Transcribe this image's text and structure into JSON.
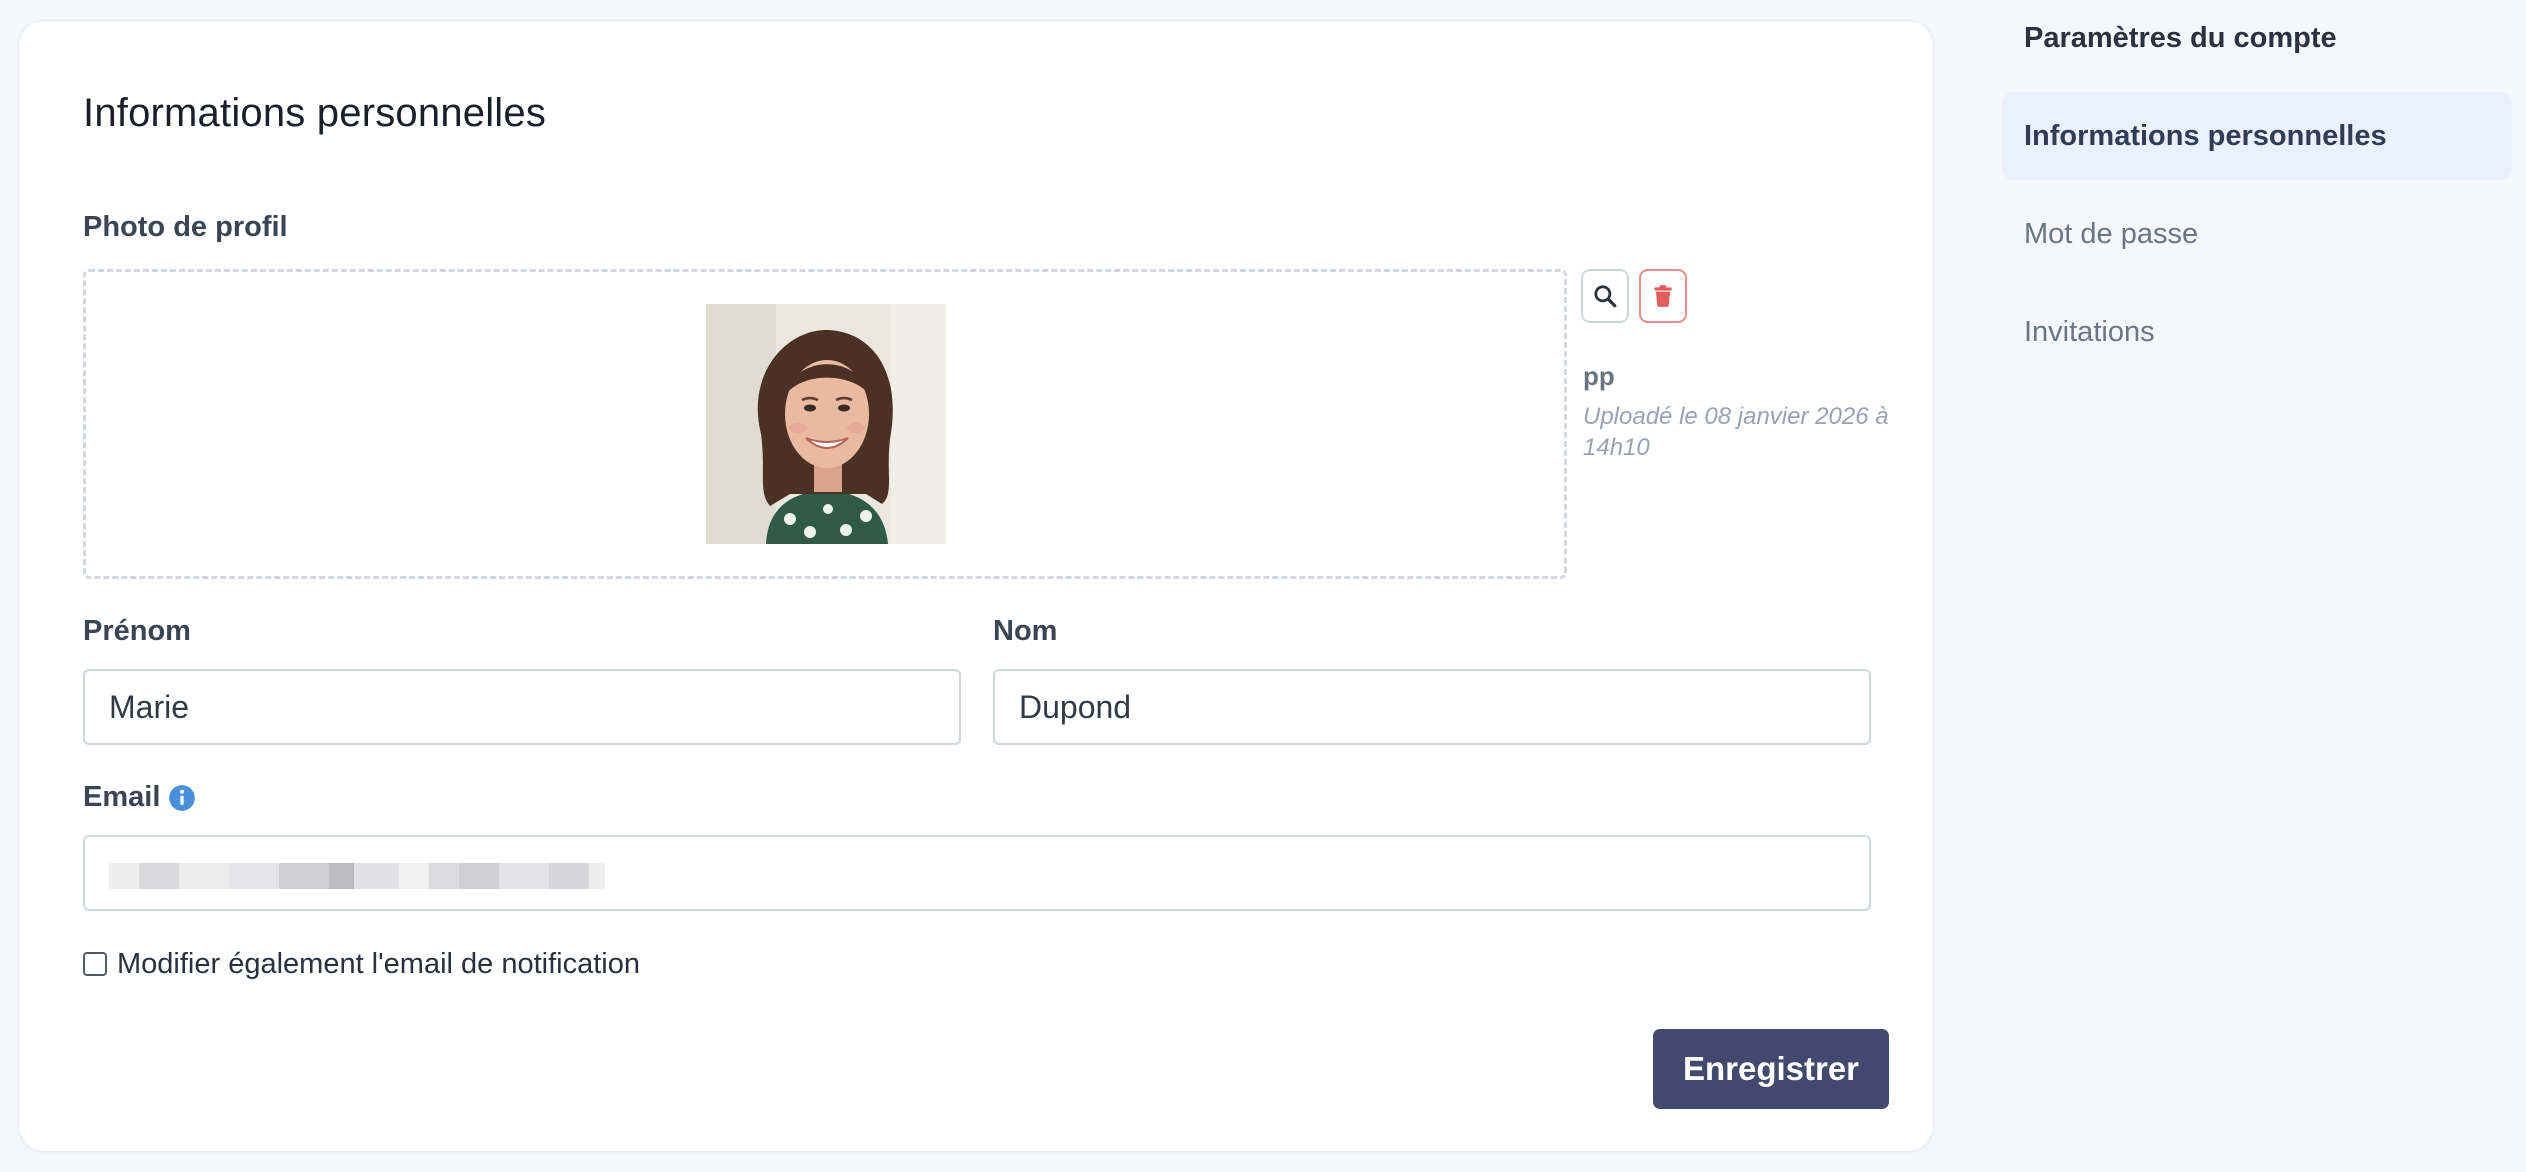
{
  "card": {
    "title": "Informations personnelles",
    "photo_label": "Photo de profil",
    "photo": {
      "file_name": "pp",
      "uploaded_text": "Uploadé le 08 janvier 2026 à 14h10"
    },
    "first_name": {
      "label": "Prénom",
      "value": "Marie"
    },
    "last_name": {
      "label": "Nom",
      "value": "Dupond"
    },
    "email": {
      "label": "Email"
    },
    "notify_checkbox": {
      "label": "Modifier également l'email de notification",
      "checked": false
    },
    "save_label": "Enregistrer"
  },
  "sidebar": {
    "title": "Paramètres du compte",
    "items": [
      {
        "label": "Informations personnelles",
        "active": true
      },
      {
        "label": "Mot de passe",
        "active": false
      },
      {
        "label": "Invitations",
        "active": false
      }
    ]
  },
  "icons": {
    "zoom": "magnifier-icon",
    "delete": "trash-icon",
    "info": "info-icon"
  },
  "colors": {
    "primary_button": "#414a6e",
    "delete_accent": "#e35d5d",
    "info_accent": "#4a90d9",
    "active_nav_bg": "#e8f1fc"
  }
}
